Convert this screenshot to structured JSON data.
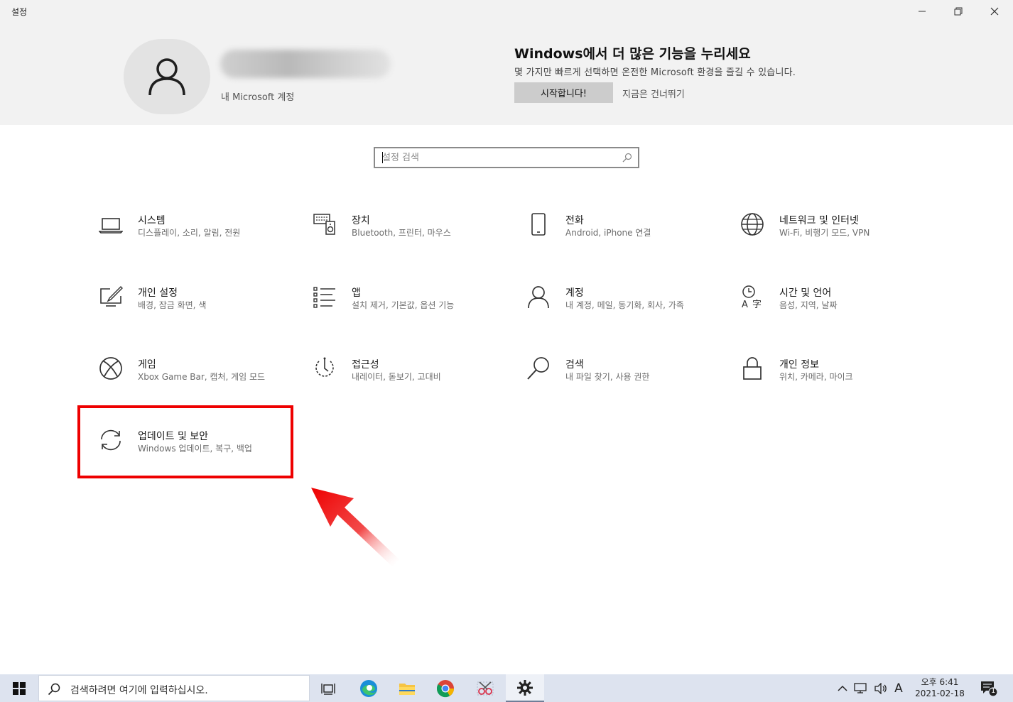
{
  "window": {
    "title": "설정",
    "minimize_icon": "minimize-icon",
    "restore_icon": "restore-icon",
    "close_icon": "close-icon"
  },
  "banner": {
    "account_label": "내 Microsoft 계정",
    "promo_title": "Windows에서 더 많은 기능을 누리세요",
    "promo_desc": "몇 가지만 빠르게 선택하면 온전한 Microsoft 환경을 즐길 수 있습니다.",
    "start_button": "시작합니다!",
    "skip_link": "지금은 건너뛰기"
  },
  "search": {
    "placeholder": "설정 검색",
    "icon": "search-icon"
  },
  "tiles": [
    {
      "name": "시스템",
      "desc": "디스플레이, 소리, 알림, 전원",
      "icon": "laptop-icon"
    },
    {
      "name": "장치",
      "desc": "Bluetooth, 프린터, 마우스",
      "icon": "devices-icon"
    },
    {
      "name": "전화",
      "desc": "Android, iPhone 연결",
      "icon": "phone-icon"
    },
    {
      "name": "네트워크 및 인터넷",
      "desc": "Wi-Fi, 비행기 모드, VPN",
      "icon": "globe-icon"
    },
    {
      "name": "개인 설정",
      "desc": "배경, 잠금 화면, 색",
      "icon": "personalization-icon"
    },
    {
      "name": "앱",
      "desc": "설치 제거, 기본값, 옵션 기능",
      "icon": "apps-list-icon"
    },
    {
      "name": "계정",
      "desc": "내 계정, 메일, 동기화, 회사, 가족",
      "icon": "account-person-icon"
    },
    {
      "name": "시간 및 언어",
      "desc": "음성, 지역, 날짜",
      "icon": "time-language-icon"
    },
    {
      "name": "게임",
      "desc": "Xbox Game Bar, 캡처, 게임 모드",
      "icon": "xbox-icon"
    },
    {
      "name": "접근성",
      "desc": "내레이터, 돋보기, 고대비",
      "icon": "ease-of-access-icon"
    },
    {
      "name": "검색",
      "desc": "내 파일 찾기, 사용 권한",
      "icon": "search-magnifier-icon"
    },
    {
      "name": "개인 정보",
      "desc": "위치, 카메라, 마이크",
      "icon": "lock-icon"
    },
    {
      "name": "업데이트 및 보안",
      "desc": "Windows 업데이트, 복구, 백업",
      "icon": "sync-arrows-icon"
    }
  ],
  "taskbar": {
    "search_placeholder": "검색하려면 여기에 입력하십시오.",
    "ime_label": "A",
    "clock_time": "오후 6:41",
    "clock_date": "2021-02-18",
    "notification_count": "1"
  },
  "colors": {
    "highlight": "#ee0000",
    "banner_bg": "#f2f2f2",
    "taskbar_bg": "#dde3ef"
  }
}
